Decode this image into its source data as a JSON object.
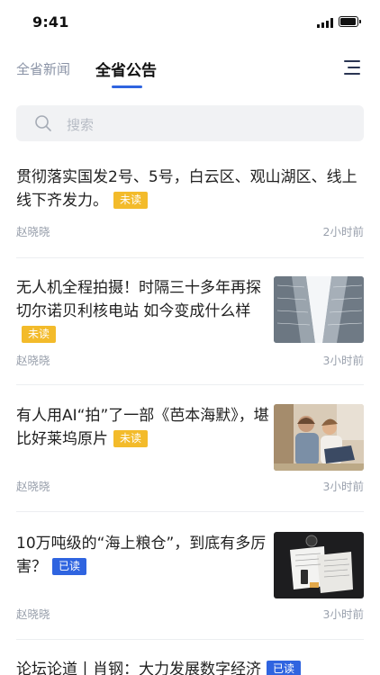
{
  "status_bar": {
    "time": "9:41"
  },
  "tabs": [
    {
      "label": "全省新闻",
      "active": false
    },
    {
      "label": "全省公告",
      "active": true
    }
  ],
  "search": {
    "placeholder": "搜索"
  },
  "articles": [
    {
      "title": "贯彻落实国发2号、5号，白云区、观山湖区、线上线下齐发力。",
      "status": "未读",
      "author": "赵晓晓",
      "time": "2小时前",
      "thumbnail": null
    },
    {
      "title": "无人机全程拍摄！时隔三十多年再探切尔诺贝利核电站 如今变成什么样",
      "status": "未读",
      "author": "赵晓晓",
      "time": "3小时前",
      "thumbnail": "skyscrapers-photo"
    },
    {
      "title": "有人用AI“拍”了一部《芭本海默》，堪比好莱坞原片",
      "status": "未读",
      "author": "赵晓晓",
      "time": "3小时前",
      "thumbnail": "couple-laptop-photo"
    },
    {
      "title": "10万吨级的“海上粮仓”，到底有多厉害？",
      "status": "已读",
      "author": "赵晓晓",
      "time": "3小时前",
      "thumbnail": "desk-documents-photo"
    },
    {
      "title": "论坛论道丨肖钢：大力发展数字经济",
      "status": "已读",
      "author": "",
      "time": "",
      "thumbnail": null
    }
  ],
  "colors": {
    "accent": "#2f64e0",
    "unread_badge": "#f3bb2b",
    "read_badge": "#2f64e0",
    "muted_text": "#9aa1ad"
  }
}
